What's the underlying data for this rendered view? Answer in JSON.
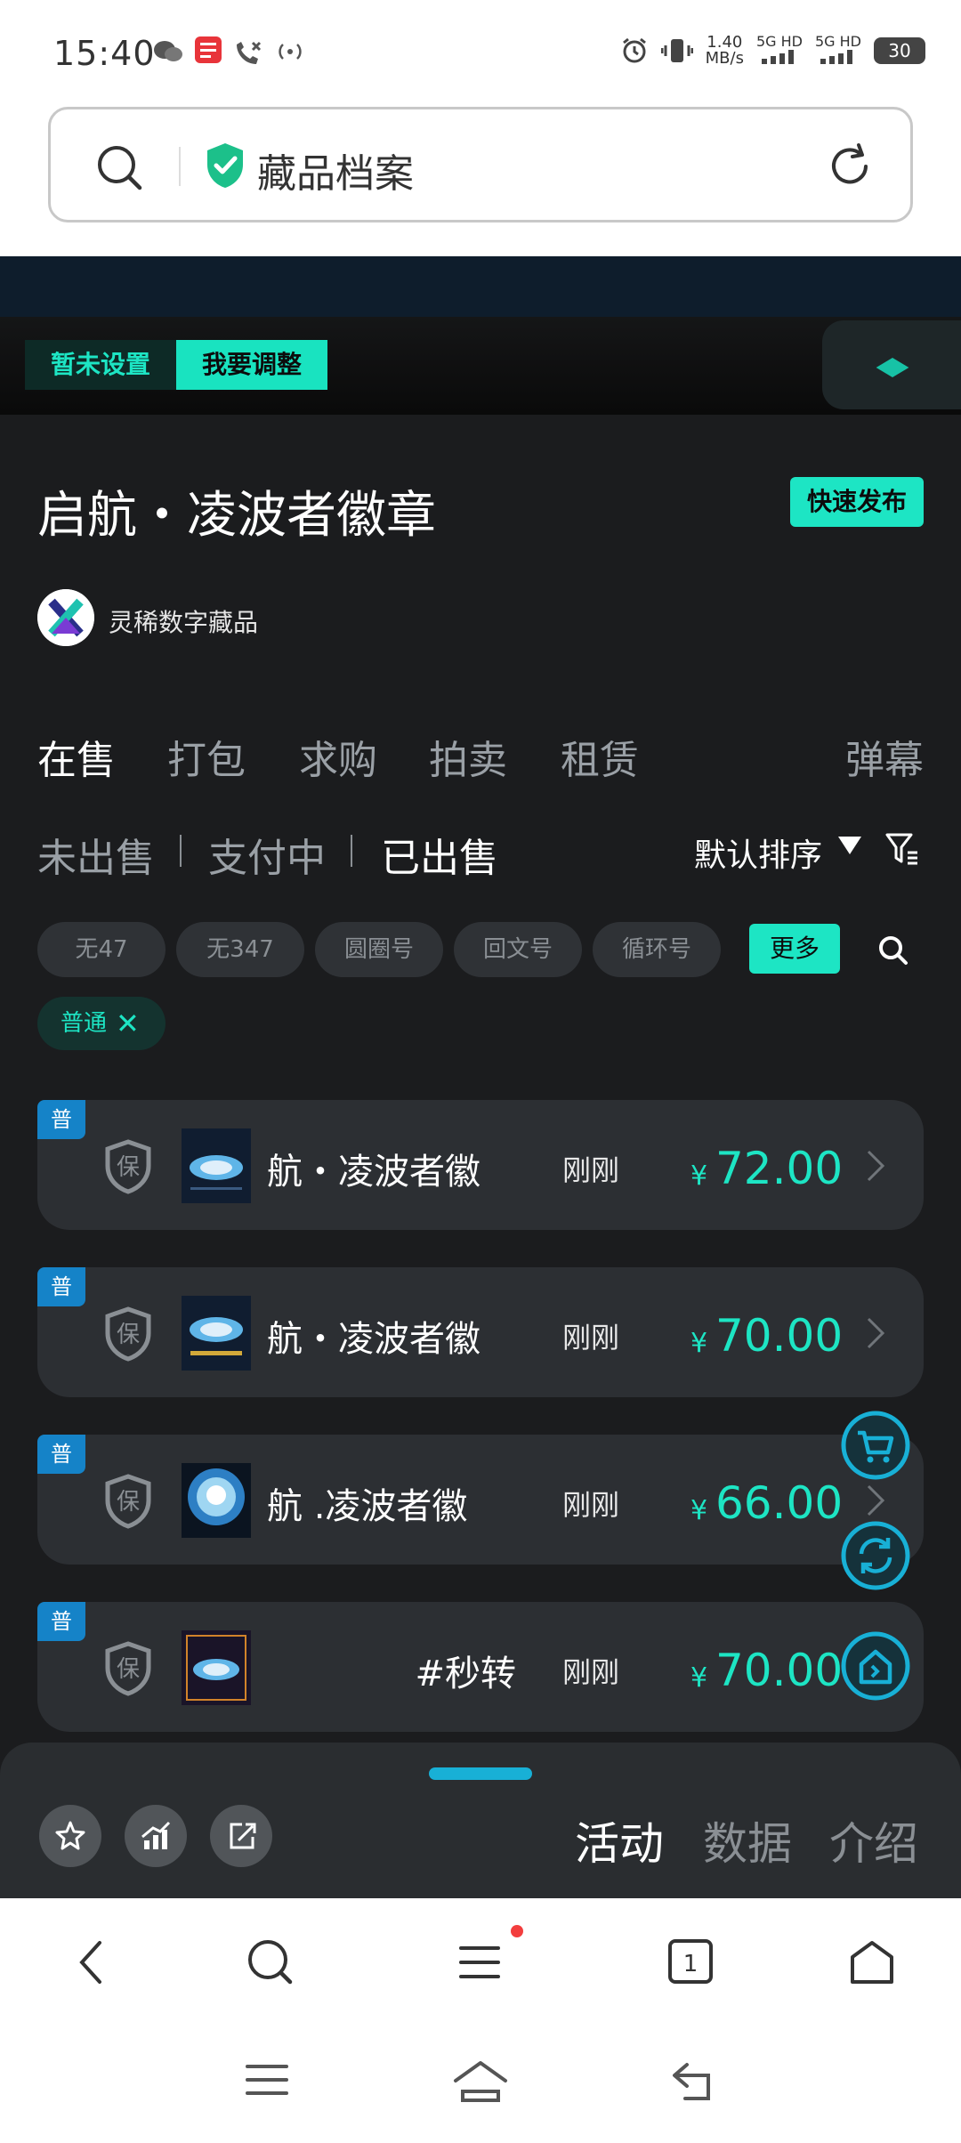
{
  "status_bar": {
    "time": "15:40",
    "speed_top": "1.40",
    "speed_bottom": "MB/s",
    "sig1": "5G HD",
    "sig2": "5G HD",
    "battery": "30"
  },
  "urlbar": {
    "title": "藏品档案"
  },
  "toolbar": {
    "btn_not_set": "暂未设置",
    "btn_adjust": "我要调整"
  },
  "header": {
    "title": "启航・凌波者徽章",
    "quick_publish": "快速发布",
    "publisher": "灵稀数字藏品"
  },
  "tabs": {
    "items": [
      "在售",
      "打包",
      "求购",
      "拍卖",
      "租赁"
    ],
    "danmu": "弹幕"
  },
  "subtabs": {
    "items": [
      "未出售",
      "支付中",
      "已出售"
    ],
    "sort": "默认排序"
  },
  "filters": {
    "chips": [
      "无47",
      "无347",
      "圆圈号",
      "回文号",
      "循环号"
    ],
    "more": "更多",
    "active_chip": "普通"
  },
  "listings": [
    {
      "badge": "普",
      "shield": "保",
      "name": "启航・凌波者徽",
      "name_visible": "航・凌波者徽",
      "time": "刚刚",
      "currency": "¥",
      "price": "72.00"
    },
    {
      "badge": "普",
      "shield": "保",
      "name": "启航・凌波者徽",
      "name_visible": "航・凌波者徽",
      "time": "刚刚",
      "currency": "¥",
      "price": "70.00"
    },
    {
      "badge": "普",
      "shield": "保",
      "name": "启航 .凌波者徽",
      "name_visible": "航 .凌波者徽",
      "time": "刚刚",
      "currency": "¥",
      "price": "66.00"
    },
    {
      "badge": "普",
      "shield": "保",
      "name": "#秒转",
      "name_visible": "#秒转",
      "time": "刚刚",
      "currency": "¥",
      "price": "70.00"
    }
  ],
  "bottom_panel": {
    "tabs": [
      "活动",
      "数据",
      "介绍"
    ]
  },
  "browser_nav": {
    "tab_count": "1"
  },
  "colors": {
    "accent": "#1de5c4",
    "page_bg": "#1b1c1e",
    "row_bg": "#2c2f33",
    "badge_blue": "#1583c8",
    "float_cyan": "#18b0d6"
  }
}
